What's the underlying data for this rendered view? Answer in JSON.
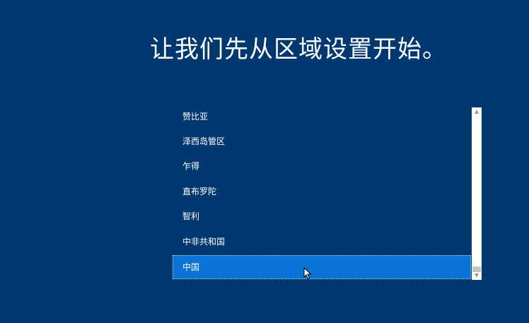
{
  "title": "让我们先从区域设置开始。",
  "regions": [
    {
      "label": "赞比亚",
      "selected": false
    },
    {
      "label": "泽西岛管区",
      "selected": false
    },
    {
      "label": "乍得",
      "selected": false
    },
    {
      "label": "直布罗陀",
      "selected": false
    },
    {
      "label": "智利",
      "selected": false
    },
    {
      "label": "中非共和国",
      "selected": false
    },
    {
      "label": "中国",
      "selected": true
    }
  ],
  "scrollbar": {
    "up_icon": "chevron-up-icon",
    "down_icon": "chevron-down-icon",
    "position_fraction": 0.93
  },
  "colors": {
    "background": "#00386f",
    "selection": "#0a74d6",
    "text": "#ffffff"
  }
}
